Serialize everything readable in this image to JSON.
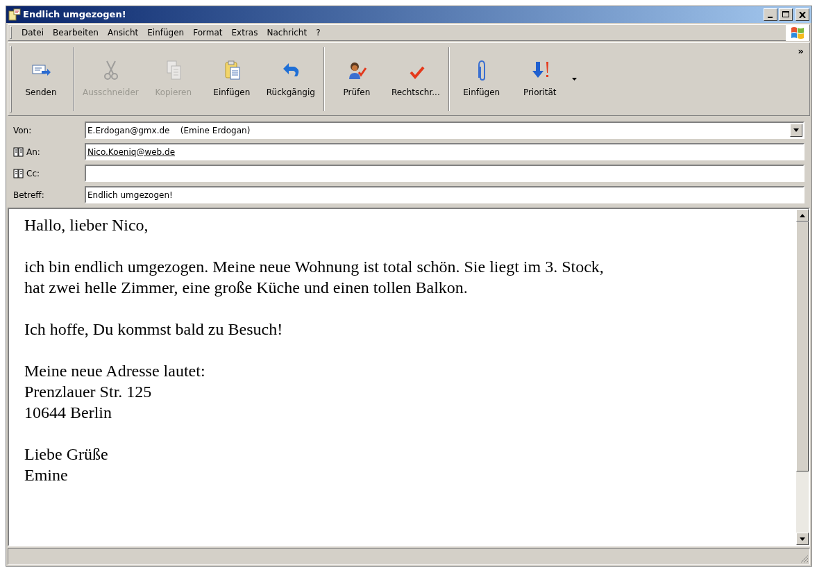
{
  "window": {
    "title": "Endlich umgezogen!"
  },
  "menu": [
    "Datei",
    "Bearbeiten",
    "Ansicht",
    "Einfügen",
    "Format",
    "Extras",
    "Nachricht",
    "?"
  ],
  "toolbar": {
    "groups": [
      [
        {
          "label": "Senden",
          "kind": "send",
          "disabled": false
        }
      ],
      [
        {
          "label": "Ausschneider",
          "kind": "cut",
          "disabled": true
        },
        {
          "label": "Kopieren",
          "kind": "copy",
          "disabled": true
        },
        {
          "label": "Einfügen",
          "kind": "paste",
          "disabled": false
        },
        {
          "label": "Rückgängig",
          "kind": "undo",
          "disabled": false
        }
      ],
      [
        {
          "label": "Prüfen",
          "kind": "check",
          "disabled": false
        },
        {
          "label": "Rechtschr...",
          "kind": "spell",
          "disabled": false
        }
      ],
      [
        {
          "label": "Einfügen",
          "kind": "attach",
          "disabled": false
        },
        {
          "label": "Priorität",
          "kind": "priority",
          "disabled": false,
          "dropdown": true
        }
      ]
    ],
    "overflow": "»"
  },
  "fields": [
    {
      "label": "Von:",
      "kind": "dropdown",
      "value": "E.Erdogan@gmx.de    (Emine Erdogan)",
      "address_book": false
    },
    {
      "label": "An:",
      "kind": "text",
      "value": "Nico.Koeniq@web.de",
      "resolved": true,
      "address_book": true
    },
    {
      "label": "Cc:",
      "kind": "text",
      "address_book": true
    },
    {
      "label": "Betreff:",
      "kind": "text",
      "value": "Endlich umgezogen!",
      "address_book": false
    }
  ],
  "body": [
    [
      "Hallo, lieber Nico,"
    ],
    [
      "ich bin endlich umgezogen. Meine neue Wohnung ist total schön. Sie liegt im 3. Stock,",
      "hat zwei helle Zimmer, eine große Küche und einen tollen Balkon."
    ],
    [
      "Ich hoffe, Du kommst bald zu Besuch!"
    ],
    [
      "Meine neue Adresse lautet:",
      "Prenzlauer Str. 125",
      "10644 Berlin"
    ],
    [
      "Liebe Grüße",
      "Emine"
    ]
  ]
}
